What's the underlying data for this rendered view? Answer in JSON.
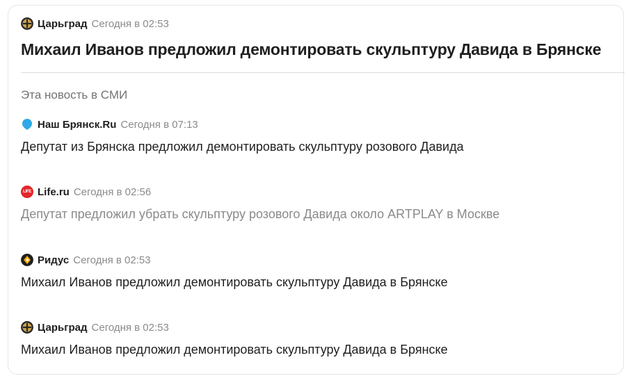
{
  "main": {
    "source": "Царьград",
    "time": "Сегодня в 02:53",
    "title": "Михаил Иванов предложил демонтировать скульптуру Давида в Брянске"
  },
  "section_title": "Эта новость в СМИ",
  "items": [
    {
      "source": "Наш Брянск.Ru",
      "time": "Сегодня в 07:13",
      "title": "Депутат из Брянска предложил демонтировать скульптуру розового Давида",
      "icon": "drop-icon"
    },
    {
      "source": "Life.ru",
      "time": "Сегодня в 02:56",
      "title": "Депутат предложил убрать скульптуру розового Давида около ARTPLAY в Москве",
      "icon": "life-logo-icon",
      "icon_text": "LIFE"
    },
    {
      "source": "Ридус",
      "time": "Сегодня в 02:53",
      "title": "Михаил Иванов предложил демонтировать скульптуру Давида в Брянске",
      "icon": "ridus-logo-icon"
    },
    {
      "source": "Царьград",
      "time": "Сегодня в 02:53",
      "title": "Михаил Иванов предложил демонтировать скульптуру Давида в Брянске",
      "icon": "tsargrad-logo-icon"
    }
  ],
  "colors": {
    "text": "#1f1f1f",
    "muted": "#8a8a8a",
    "life_red": "#e3262a",
    "drop_blue": "#2fa8e6",
    "tsargrad_gold": "#c8a04a"
  }
}
